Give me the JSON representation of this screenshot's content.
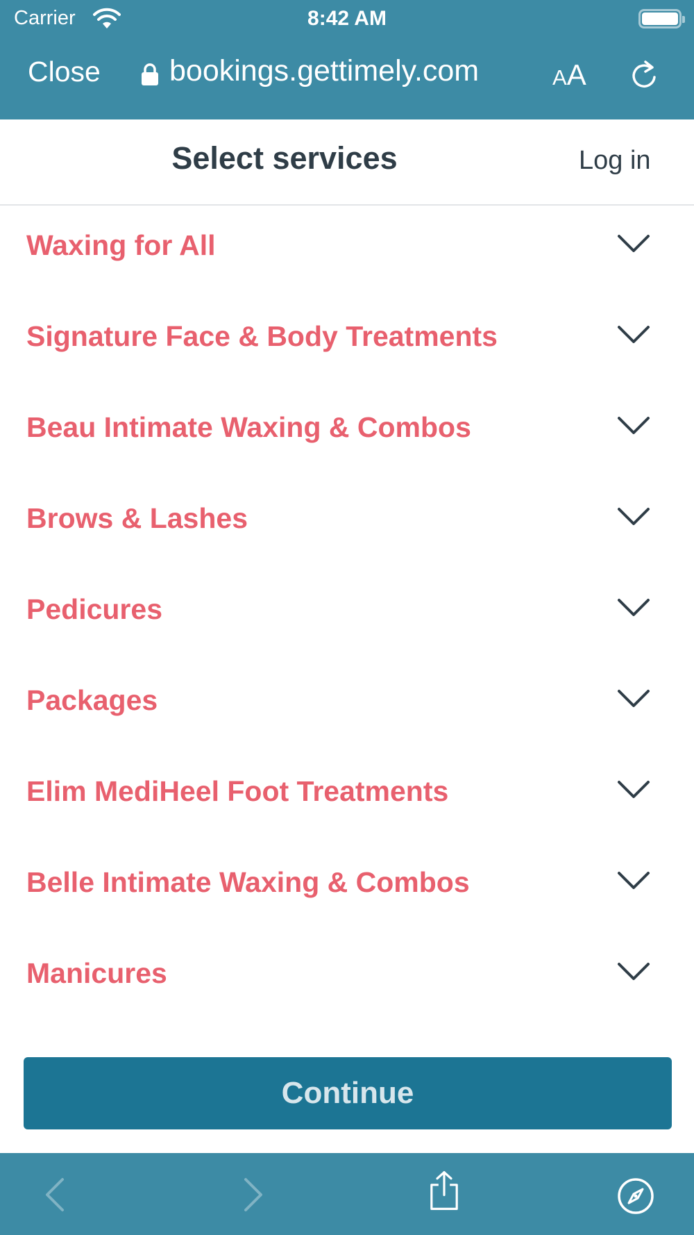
{
  "status_bar": {
    "carrier": "Carrier",
    "time": "8:42 AM",
    "wifi_icon": "wifi-icon",
    "battery_icon": "battery-icon"
  },
  "browser": {
    "close_label": "Close",
    "url": "bookings.gettimely.com",
    "text_size_small": "A",
    "text_size_big": "A",
    "lock_icon": "lock-icon",
    "reload_icon": "reload-icon",
    "chrome_color": "#3d8ba5"
  },
  "header": {
    "title": "Select services",
    "login_label": "Log in"
  },
  "categories": [
    {
      "label": "Waxing for All"
    },
    {
      "label": "Signature Face & Body Treatments"
    },
    {
      "label": "Beau Intimate Waxing & Combos"
    },
    {
      "label": "Brows & Lashes"
    },
    {
      "label": "Pedicures"
    },
    {
      "label": "Packages"
    },
    {
      "label": "Elim MediHeel Foot Treatments"
    },
    {
      "label": "Belle Intimate Waxing & Combos"
    },
    {
      "label": "Manicures"
    }
  ],
  "category_accent": "#e8606e",
  "continue_label": "Continue",
  "continue_color": "#1c7594",
  "toolbar": {
    "back_icon": "back-icon",
    "forward_icon": "forward-icon",
    "share_icon": "share-icon",
    "compass_icon": "compass-icon"
  }
}
